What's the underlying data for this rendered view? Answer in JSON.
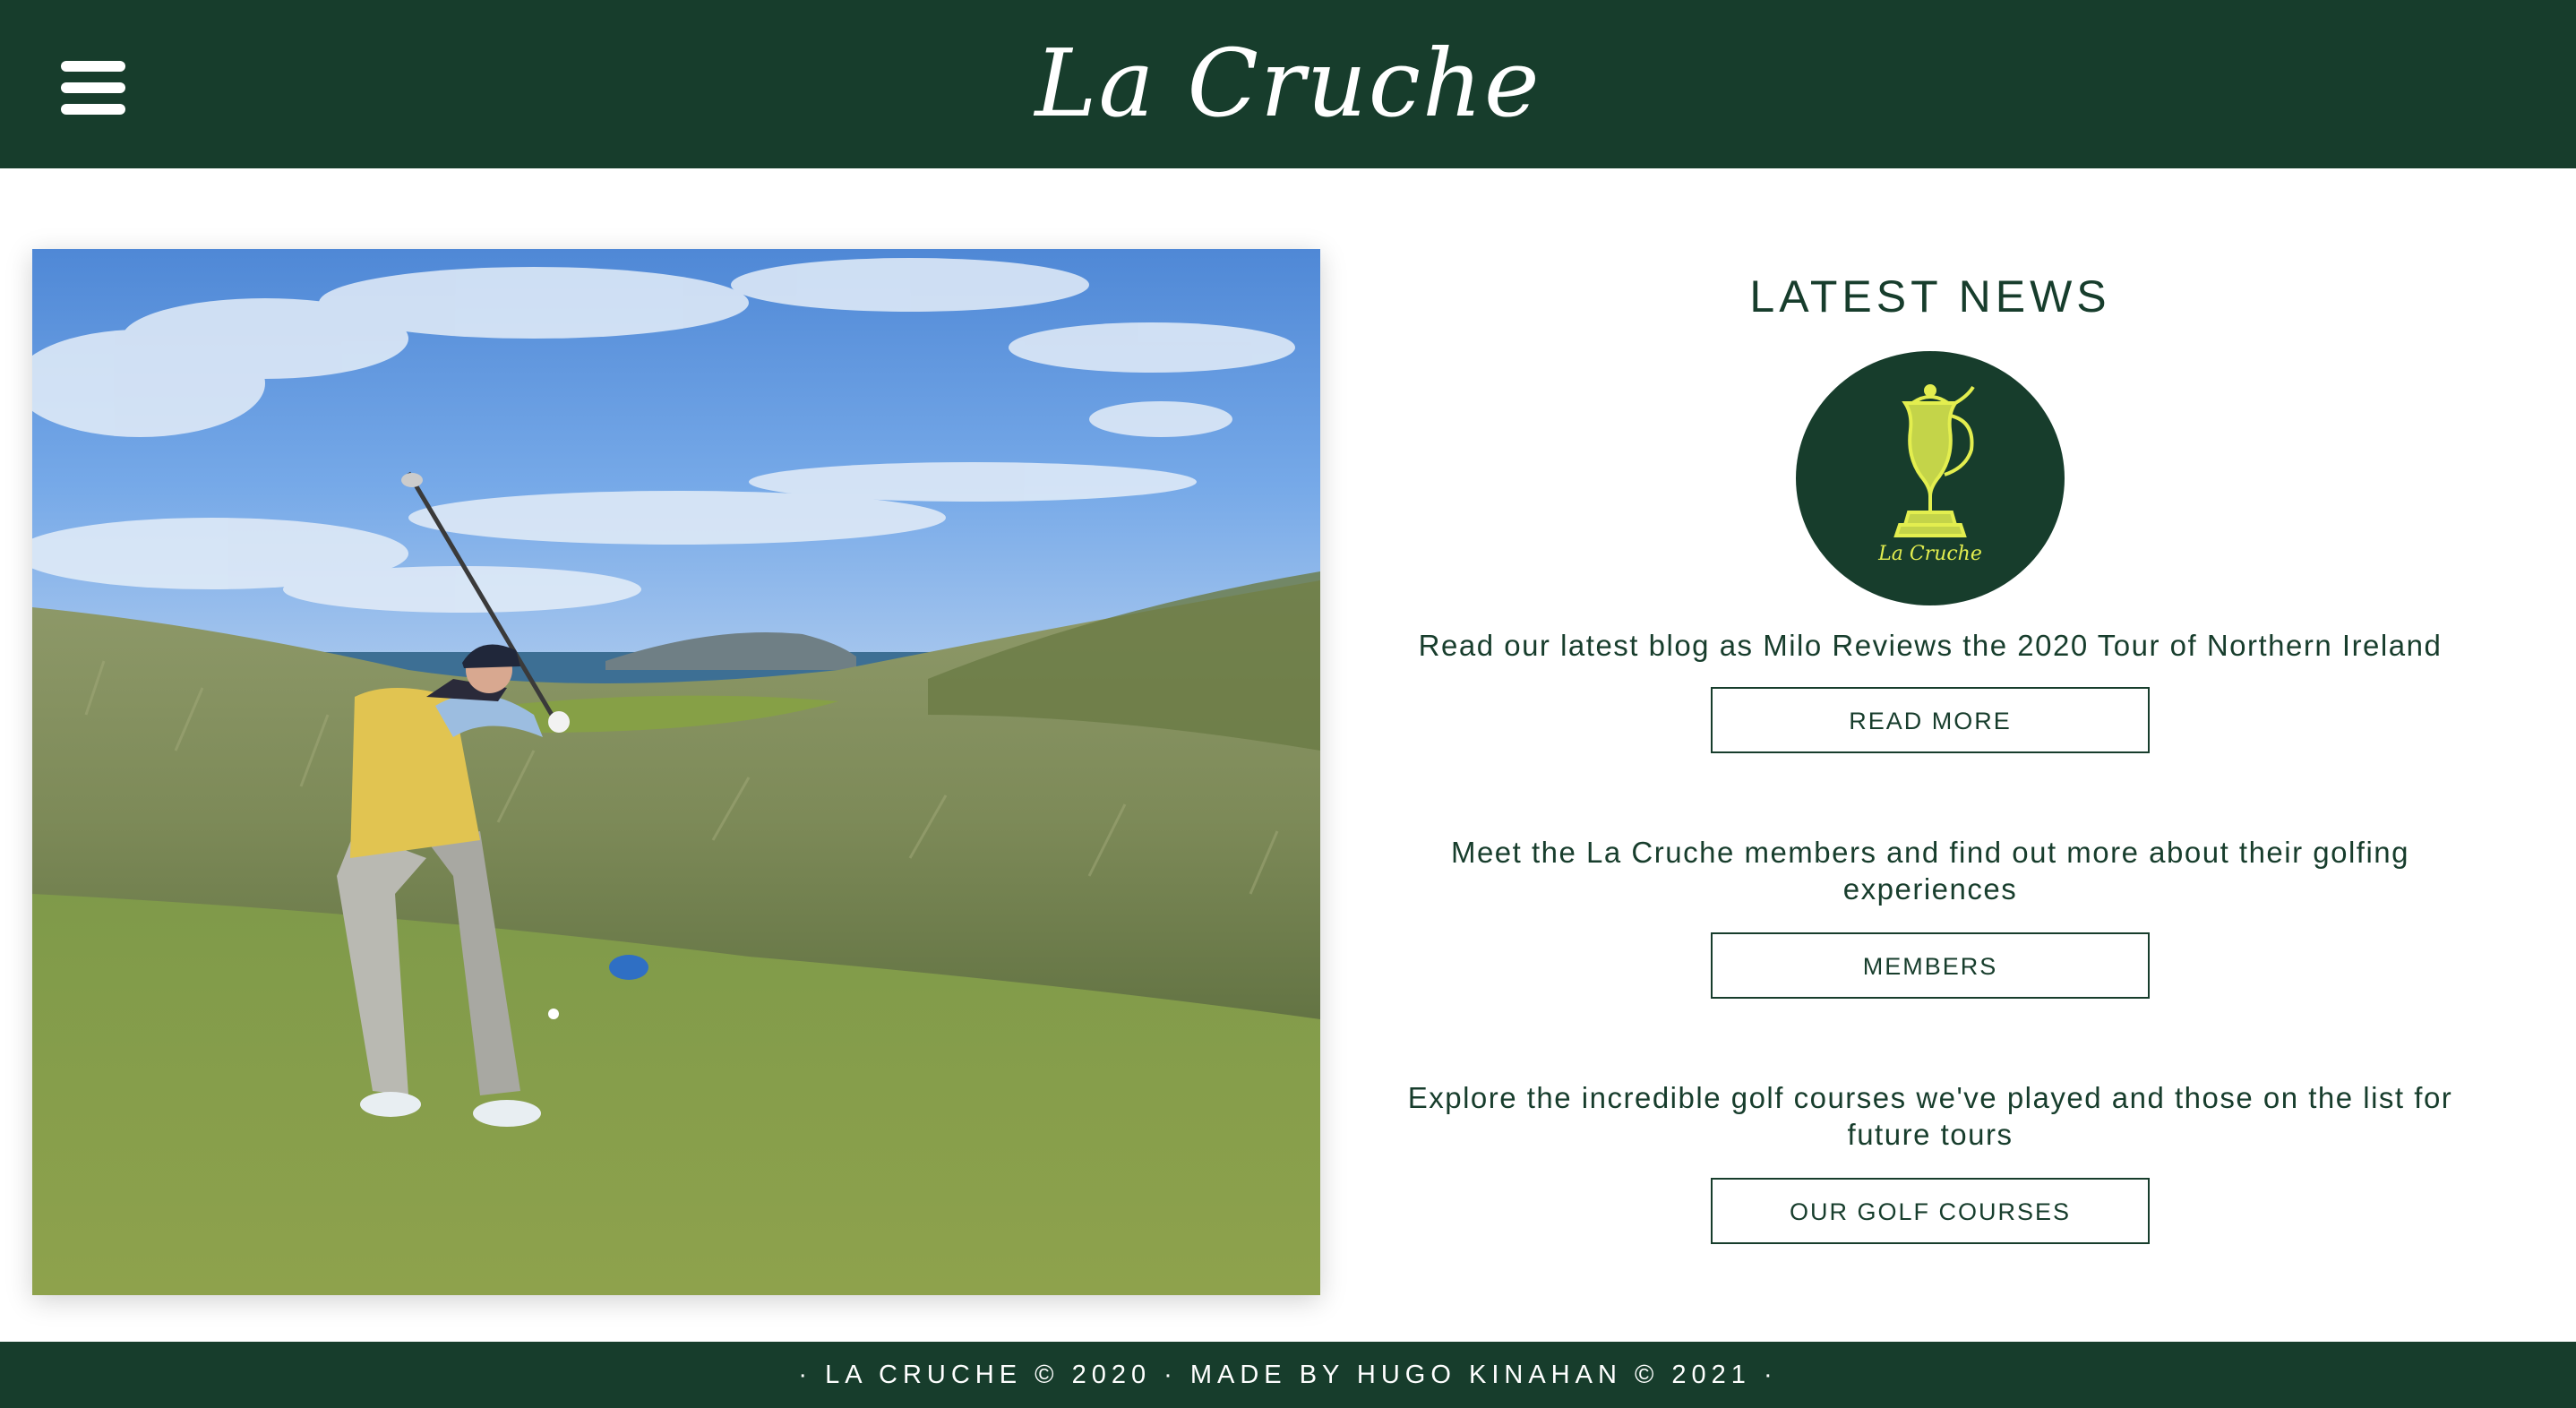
{
  "header": {
    "brand": "La Cruche",
    "menu_icon": "hamburger-menu-icon",
    "background_color": "#173d2c"
  },
  "hero_image": {
    "subject": "golf-swing-photo"
  },
  "news": {
    "title": "LATEST NEWS",
    "logo_text": "La Cruche",
    "logo_icon": "claret-jug-trophy-icon",
    "items": [
      {
        "text": "Read our latest blog as Milo Reviews the 2020 Tour of Northern Ireland",
        "button": "READ MORE"
      },
      {
        "text": "Meet the La Cruche members and find out more about their golfing experiences",
        "button": "MEMBERS"
      },
      {
        "text": "Explore the incredible golf courses we've played and those on the list for future tours",
        "button": "OUR GOLF COURSES"
      }
    ]
  },
  "footer": {
    "text": "· LA CRUCHE © 2020 · MADE BY HUGO KINAHAN © 2021 ·"
  },
  "colors": {
    "brand_green": "#173d2c",
    "logo_yellow": "#e3ee4f",
    "background": "#ffffff"
  }
}
